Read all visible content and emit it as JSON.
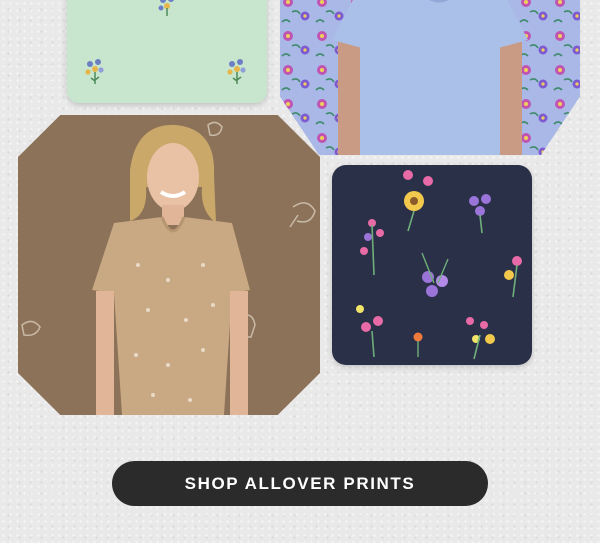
{
  "tiles": {
    "mint": {
      "name": "mint-floral-swatch",
      "color": "#c7e6cd"
    },
    "lavender": {
      "name": "lavender-floral-tee",
      "color": "#a9b8e6"
    },
    "model": {
      "name": "model-beige-vneck-tee",
      "color": "#8c7258"
    },
    "navy": {
      "name": "navy-floral-swatch",
      "color": "#2a3048"
    }
  },
  "cta": {
    "label": "SHOP ALLOVER PRINTS",
    "background": "#2b2b2b",
    "text_color": "#ffffff"
  }
}
